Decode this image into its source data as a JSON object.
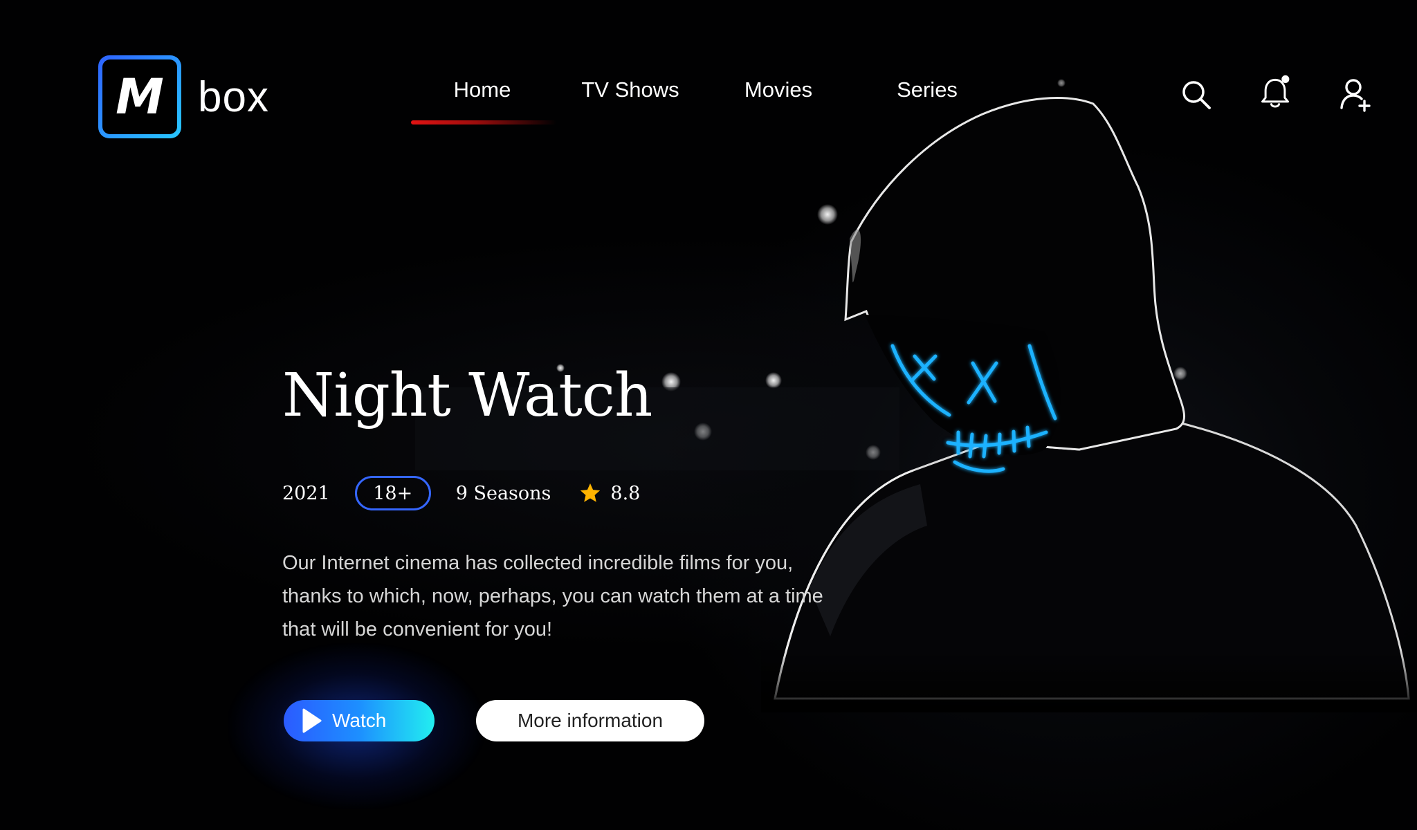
{
  "brand": {
    "logo_letter": "M",
    "name": "box"
  },
  "nav": {
    "items": [
      {
        "label": "Home",
        "active": true
      },
      {
        "label": "TV Shows",
        "active": false
      },
      {
        "label": "Movies",
        "active": false
      },
      {
        "label": "Series",
        "active": false
      }
    ]
  },
  "header_icons": [
    "search-icon",
    "bell-icon",
    "add-user-icon"
  ],
  "hero": {
    "title": "Night Watch",
    "year": "2021",
    "age_rating": "18+",
    "seasons": "9 Seasons",
    "rating": "8.8",
    "description_lines": [
      "Our Internet cinema has collected incredible films for you,",
      "thanks to which, now, perhaps, you can watch them at a time",
      "that will be convenient for you!"
    ],
    "watch_label": "Watch",
    "more_label": "More information"
  },
  "colors": {
    "accent_blue": "#3566ff",
    "accent_cyan": "#22eef0",
    "nav_active_underline": "#e11313",
    "star": "#ffb400",
    "mask_glow": "#1fb2ff"
  }
}
